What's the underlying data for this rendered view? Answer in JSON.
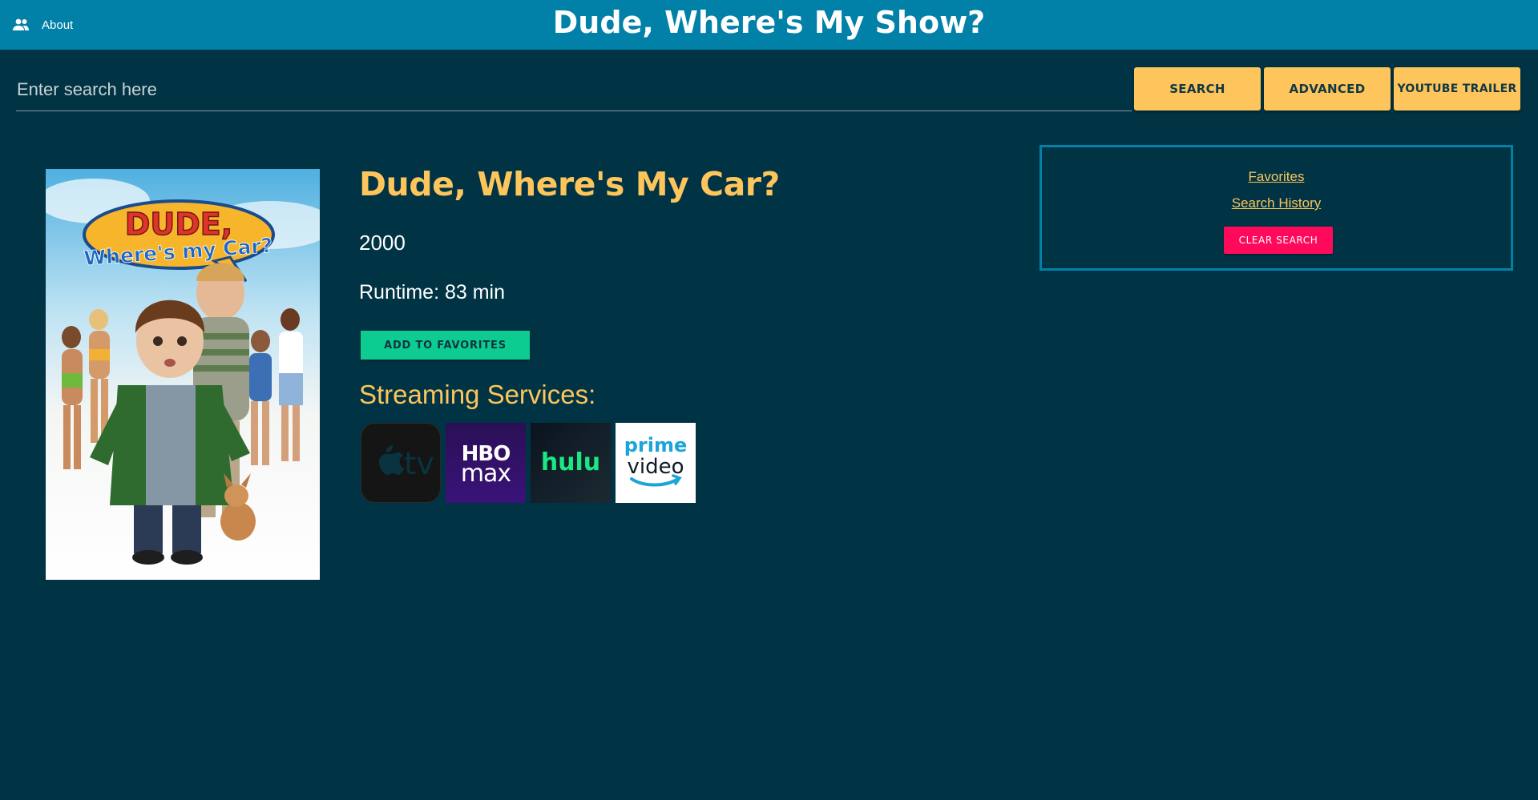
{
  "header": {
    "about_label": "About",
    "site_title": "Dude, Where's My Show?"
  },
  "search": {
    "placeholder": "Enter search here",
    "search_label": "SEARCH",
    "advanced_label": "ADVANCED",
    "trailer_label": "YOUTUBE TRAILER"
  },
  "movie": {
    "poster_lettering": [
      "DUDE,",
      "Where's my Car?"
    ],
    "title": "Dude, Where's My Car?",
    "year": "2000",
    "runtime": "Runtime: 83 min",
    "add_favorites_label": "ADD TO FAVORITES",
    "streaming_heading": "Streaming Services:",
    "services": [
      {
        "name": "Apple TV",
        "logo_text": "tv",
        "icon": "apple-tv-icon"
      },
      {
        "name": "HBO Max",
        "logo_text": [
          "HBO",
          "max"
        ],
        "icon": "hbo-max-icon"
      },
      {
        "name": "Hulu",
        "logo_text": "hulu",
        "icon": "hulu-icon"
      },
      {
        "name": "Prime Video",
        "logo_text": [
          "prime",
          "video"
        ],
        "icon": "prime-video-icon"
      }
    ]
  },
  "side_panel": {
    "favorites_link": "Favorites",
    "history_link": "Search History",
    "clear_label": "CLEAR SEARCH"
  },
  "colors": {
    "background": "#003344",
    "header": "#0180a8",
    "accent_yellow": "#fdc55b",
    "favorites_green": "#0dcc91",
    "clear_red": "#ff0a5a"
  }
}
